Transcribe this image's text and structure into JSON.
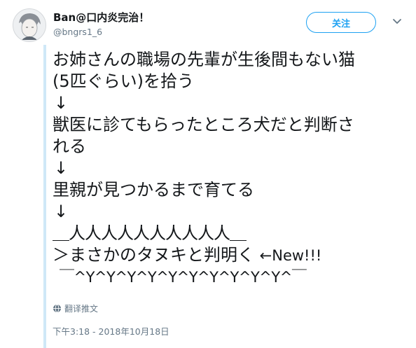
{
  "user": {
    "display_name": "Ban@口内炎完治！",
    "handle": "@bngrs1_6"
  },
  "follow_button": {
    "label": "关注"
  },
  "tweet": {
    "lines": [
      "お姉さんの職場の先輩が生後間もない猫",
      "(5匹ぐらい)を拾う",
      "↓",
      "獣医に診てもらったところ犬だと判断さ",
      "れる",
      "↓",
      "里親が見つかるまで育てる",
      "↓",
      "＿人人人人人人人人人人＿",
      "＞まさかのタヌキと判明く",
      "￣^Y^Y^Y^Y^Y^Y^Y^Y^Y^Y^￣"
    ],
    "new_annotation": "←New!!!"
  },
  "translate": {
    "label": "翻译推文",
    "icon": "globe-icon"
  },
  "timestamp": "下午3:18 - 2018年10月18日",
  "colors": {
    "accent": "#1da1f2",
    "text": "#14171a",
    "secondary": "#657786",
    "thread": "#cfe8f7"
  }
}
